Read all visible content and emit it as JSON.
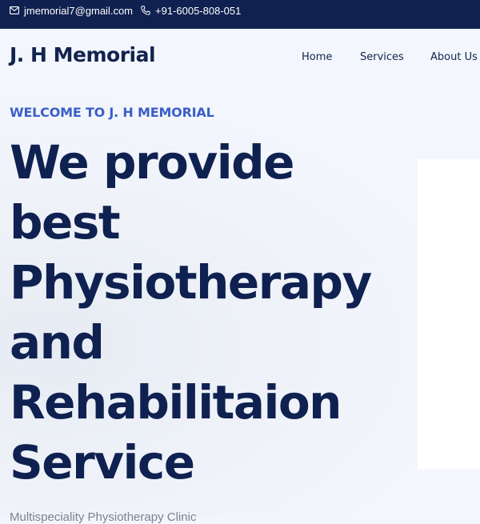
{
  "topbar": {
    "email": "jmemorial7@gmail.com",
    "email_icon": "mail-icon",
    "phone": "+91-6005-808-051",
    "phone_icon": "phone-icon"
  },
  "header": {
    "logo": "J. H Memorial",
    "nav": [
      "Home",
      "Services",
      "About Us"
    ]
  },
  "hero": {
    "welcome": "WELCOME TO J. H MEMORIAL",
    "headline_lines": [
      "We provide",
      "best",
      "Physiotherapy",
      "and",
      "Rehabilitaion",
      "Service"
    ],
    "subtitle": "Multispeciality Physiotherapy Clinic"
  },
  "colors": {
    "topbar_bg": "#0f2150",
    "headline": "#0f2150",
    "accent": "#3b5fc8",
    "page_bg": "#f3f6fc"
  }
}
